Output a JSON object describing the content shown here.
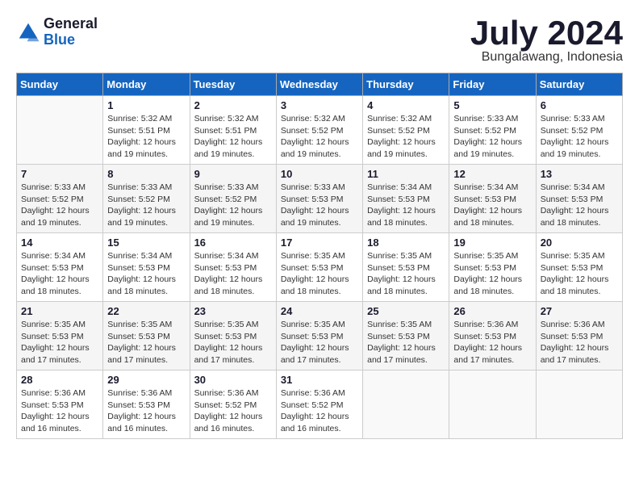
{
  "header": {
    "logo_line1": "General",
    "logo_line2": "Blue",
    "month_title": "July 2024",
    "location": "Bungalawang, Indonesia"
  },
  "weekdays": [
    "Sunday",
    "Monday",
    "Tuesday",
    "Wednesday",
    "Thursday",
    "Friday",
    "Saturday"
  ],
  "weeks": [
    [
      {
        "day": "",
        "info": ""
      },
      {
        "day": "1",
        "info": "Sunrise: 5:32 AM\nSunset: 5:51 PM\nDaylight: 12 hours\nand 19 minutes."
      },
      {
        "day": "2",
        "info": "Sunrise: 5:32 AM\nSunset: 5:51 PM\nDaylight: 12 hours\nand 19 minutes."
      },
      {
        "day": "3",
        "info": "Sunrise: 5:32 AM\nSunset: 5:52 PM\nDaylight: 12 hours\nand 19 minutes."
      },
      {
        "day": "4",
        "info": "Sunrise: 5:32 AM\nSunset: 5:52 PM\nDaylight: 12 hours\nand 19 minutes."
      },
      {
        "day": "5",
        "info": "Sunrise: 5:33 AM\nSunset: 5:52 PM\nDaylight: 12 hours\nand 19 minutes."
      },
      {
        "day": "6",
        "info": "Sunrise: 5:33 AM\nSunset: 5:52 PM\nDaylight: 12 hours\nand 19 minutes."
      }
    ],
    [
      {
        "day": "7",
        "info": "Sunrise: 5:33 AM\nSunset: 5:52 PM\nDaylight: 12 hours\nand 19 minutes."
      },
      {
        "day": "8",
        "info": "Sunrise: 5:33 AM\nSunset: 5:52 PM\nDaylight: 12 hours\nand 19 minutes."
      },
      {
        "day": "9",
        "info": "Sunrise: 5:33 AM\nSunset: 5:52 PM\nDaylight: 12 hours\nand 19 minutes."
      },
      {
        "day": "10",
        "info": "Sunrise: 5:33 AM\nSunset: 5:53 PM\nDaylight: 12 hours\nand 19 minutes."
      },
      {
        "day": "11",
        "info": "Sunrise: 5:34 AM\nSunset: 5:53 PM\nDaylight: 12 hours\nand 18 minutes."
      },
      {
        "day": "12",
        "info": "Sunrise: 5:34 AM\nSunset: 5:53 PM\nDaylight: 12 hours\nand 18 minutes."
      },
      {
        "day": "13",
        "info": "Sunrise: 5:34 AM\nSunset: 5:53 PM\nDaylight: 12 hours\nand 18 minutes."
      }
    ],
    [
      {
        "day": "14",
        "info": "Sunrise: 5:34 AM\nSunset: 5:53 PM\nDaylight: 12 hours\nand 18 minutes."
      },
      {
        "day": "15",
        "info": "Sunrise: 5:34 AM\nSunset: 5:53 PM\nDaylight: 12 hours\nand 18 minutes."
      },
      {
        "day": "16",
        "info": "Sunrise: 5:34 AM\nSunset: 5:53 PM\nDaylight: 12 hours\nand 18 minutes."
      },
      {
        "day": "17",
        "info": "Sunrise: 5:35 AM\nSunset: 5:53 PM\nDaylight: 12 hours\nand 18 minutes."
      },
      {
        "day": "18",
        "info": "Sunrise: 5:35 AM\nSunset: 5:53 PM\nDaylight: 12 hours\nand 18 minutes."
      },
      {
        "day": "19",
        "info": "Sunrise: 5:35 AM\nSunset: 5:53 PM\nDaylight: 12 hours\nand 18 minutes."
      },
      {
        "day": "20",
        "info": "Sunrise: 5:35 AM\nSunset: 5:53 PM\nDaylight: 12 hours\nand 18 minutes."
      }
    ],
    [
      {
        "day": "21",
        "info": "Sunrise: 5:35 AM\nSunset: 5:53 PM\nDaylight: 12 hours\nand 17 minutes."
      },
      {
        "day": "22",
        "info": "Sunrise: 5:35 AM\nSunset: 5:53 PM\nDaylight: 12 hours\nand 17 minutes."
      },
      {
        "day": "23",
        "info": "Sunrise: 5:35 AM\nSunset: 5:53 PM\nDaylight: 12 hours\nand 17 minutes."
      },
      {
        "day": "24",
        "info": "Sunrise: 5:35 AM\nSunset: 5:53 PM\nDaylight: 12 hours\nand 17 minutes."
      },
      {
        "day": "25",
        "info": "Sunrise: 5:35 AM\nSunset: 5:53 PM\nDaylight: 12 hours\nand 17 minutes."
      },
      {
        "day": "26",
        "info": "Sunrise: 5:36 AM\nSunset: 5:53 PM\nDaylight: 12 hours\nand 17 minutes."
      },
      {
        "day": "27",
        "info": "Sunrise: 5:36 AM\nSunset: 5:53 PM\nDaylight: 12 hours\nand 17 minutes."
      }
    ],
    [
      {
        "day": "28",
        "info": "Sunrise: 5:36 AM\nSunset: 5:53 PM\nDaylight: 12 hours\nand 16 minutes."
      },
      {
        "day": "29",
        "info": "Sunrise: 5:36 AM\nSunset: 5:53 PM\nDaylight: 12 hours\nand 16 minutes."
      },
      {
        "day": "30",
        "info": "Sunrise: 5:36 AM\nSunset: 5:52 PM\nDaylight: 12 hours\nand 16 minutes."
      },
      {
        "day": "31",
        "info": "Sunrise: 5:36 AM\nSunset: 5:52 PM\nDaylight: 12 hours\nand 16 minutes."
      },
      {
        "day": "",
        "info": ""
      },
      {
        "day": "",
        "info": ""
      },
      {
        "day": "",
        "info": ""
      }
    ]
  ]
}
